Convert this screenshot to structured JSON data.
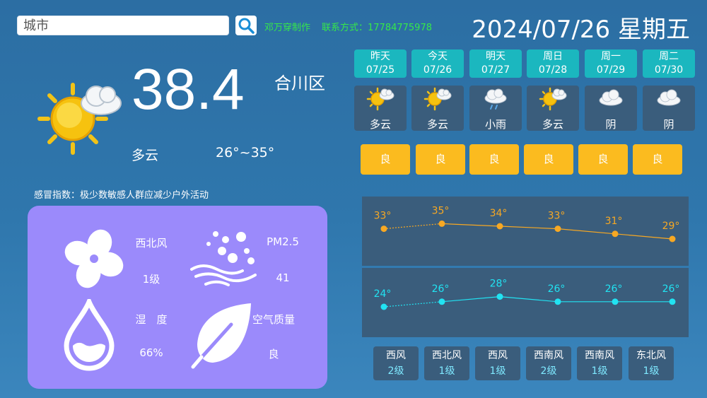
{
  "search": {
    "placeholder": "城市"
  },
  "credits": {
    "author": "邓万穿制作",
    "contact": "联系方式：17784775978"
  },
  "header": {
    "date": "2024/07/26 星期五"
  },
  "current": {
    "temperature": "38.4",
    "district": "合川区",
    "condition": "多云",
    "range": "26°~35°",
    "icon": "sun-cloud-icon"
  },
  "cold_index": "感冒指数：极少数敏感人群应减少户外活动",
  "details": {
    "wind_dir": "西北风",
    "wind_level": "1级",
    "pm_label": "PM2.5",
    "pm_value": "41",
    "humidity_label": "湿　度",
    "humidity_value": "66%",
    "air_label": "空气质量",
    "air_value": "良"
  },
  "forecast": [
    {
      "day": "昨天",
      "date": "07/25",
      "cond": "多云",
      "icon": "sun-cloud-icon",
      "aqi": "良",
      "high": 33,
      "low": 24,
      "wind": "西风",
      "wind_level": "2级"
    },
    {
      "day": "今天",
      "date": "07/26",
      "cond": "多云",
      "icon": "sun-cloud-icon",
      "aqi": "良",
      "high": 35,
      "low": 26,
      "wind": "西北风",
      "wind_level": "1级"
    },
    {
      "day": "明天",
      "date": "07/27",
      "cond": "小雨",
      "icon": "rain-cloud-icon",
      "aqi": "良",
      "high": 34,
      "low": 28,
      "wind": "西风",
      "wind_level": "1级"
    },
    {
      "day": "周日",
      "date": "07/28",
      "cond": "多云",
      "icon": "sun-cloud-icon",
      "aqi": "良",
      "high": 33,
      "low": 26,
      "wind": "西南风",
      "wind_level": "2级"
    },
    {
      "day": "周一",
      "date": "07/29",
      "cond": "阴",
      "icon": "cloud-icon",
      "aqi": "良",
      "high": 31,
      "low": 26,
      "wind": "西南风",
      "wind_level": "1级"
    },
    {
      "day": "周二",
      "date": "07/30",
      "cond": "阴",
      "icon": "cloud-icon",
      "aqi": "良",
      "high": 29,
      "low": 26,
      "wind": "东北风",
      "wind_level": "1级"
    }
  ],
  "chart_data": {
    "type": "line",
    "categories": [
      "07/25",
      "07/26",
      "07/27",
      "07/28",
      "07/29",
      "07/30"
    ],
    "series": [
      {
        "values": [
          33,
          35,
          34,
          33,
          31,
          29
        ],
        "color": "#f7a823"
      },
      {
        "values": [
          24,
          26,
          28,
          26,
          26,
          26
        ],
        "color": "#21e3f2"
      }
    ]
  },
  "colors": {
    "accent": "#1bb7bf",
    "aqi": "#fbbb1f",
    "panel": "#9b8afb",
    "credit": "#35e84a"
  }
}
